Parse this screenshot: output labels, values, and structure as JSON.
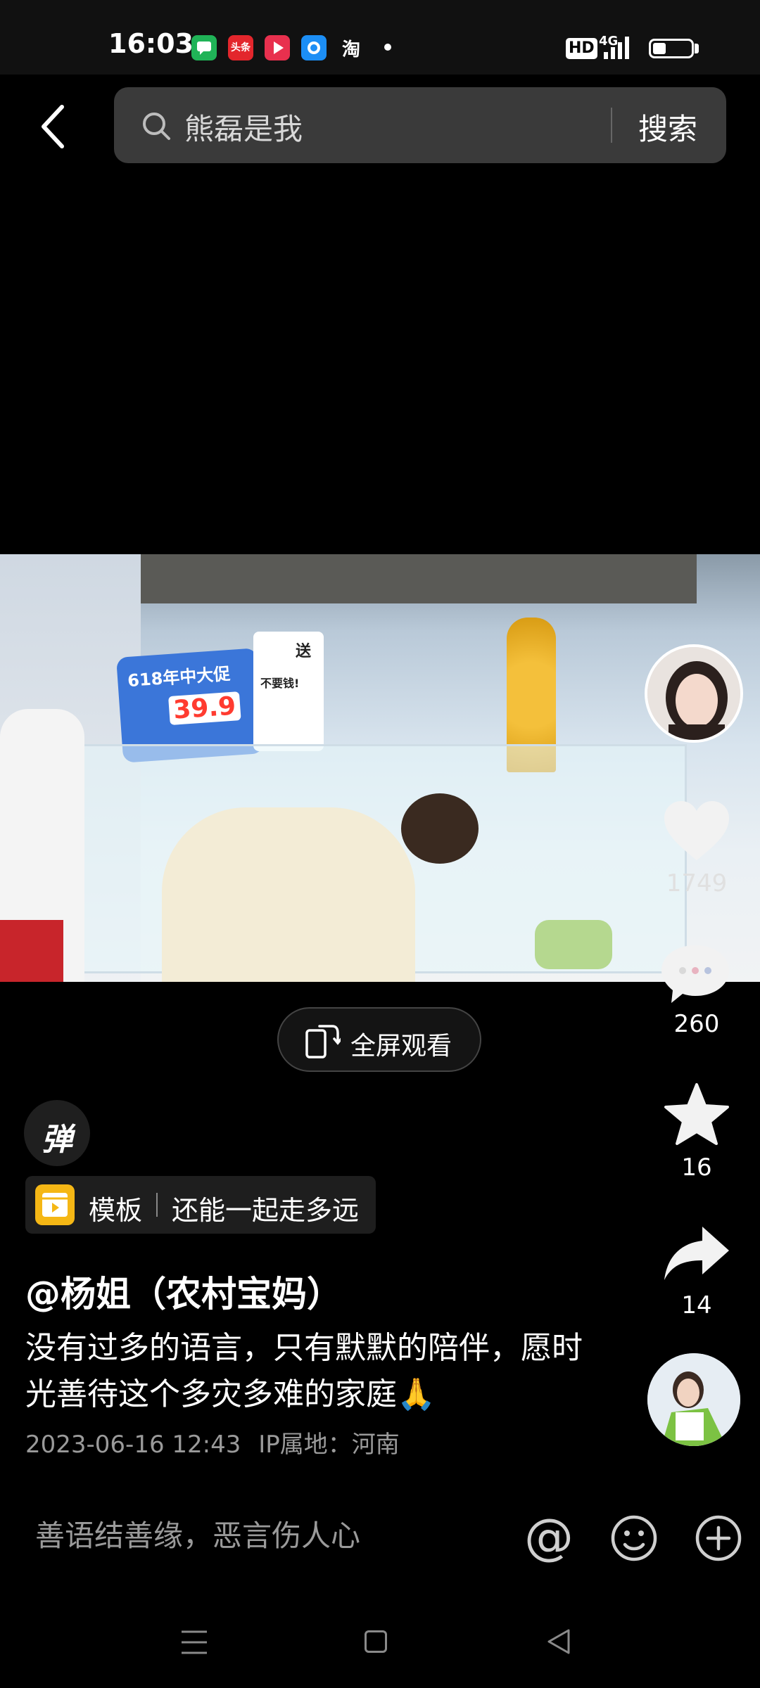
{
  "status_bar": {
    "time": "16:03",
    "apps": [
      "messages-app-icon",
      "toutiao-app-icon",
      "video-app-icon",
      "browser-app-icon",
      "taobao-app-icon"
    ],
    "toutiao_label": "头条",
    "taobao_label": "淘",
    "hd_badge": "HD",
    "network": "4G",
    "battery_percent": 35
  },
  "search": {
    "query": "熊磊是我",
    "submit_label": "搜索"
  },
  "video": {
    "fullscreen_label": "全屏观看",
    "promo_text": "618年中大促",
    "price_text": "39.9",
    "promo_gift": "送",
    "promo_free": "不要钱!"
  },
  "actions": {
    "likes": "1749",
    "comments": "260",
    "favorites": "16",
    "shares": "14"
  },
  "danmaku_label": "弹",
  "template": {
    "label": "模板",
    "song": "还能一起走多远"
  },
  "post": {
    "author": "@杨姐（农村宝妈）",
    "description": "没有过多的语言，只有默默的陪伴，愿时光善待这个多灾多难的家庭🙏",
    "timestamp": "2023-06-16 12:43",
    "ip_location": "IP属地：河南"
  },
  "comment_bar": {
    "placeholder": "善语结善缘，恶言伤人心",
    "mention_symbol": "@"
  },
  "colors": {
    "background": "#000000",
    "search_box": "#3a3a3a",
    "template_icon": "#f5b715",
    "muted_text": "#9a9a9a"
  }
}
